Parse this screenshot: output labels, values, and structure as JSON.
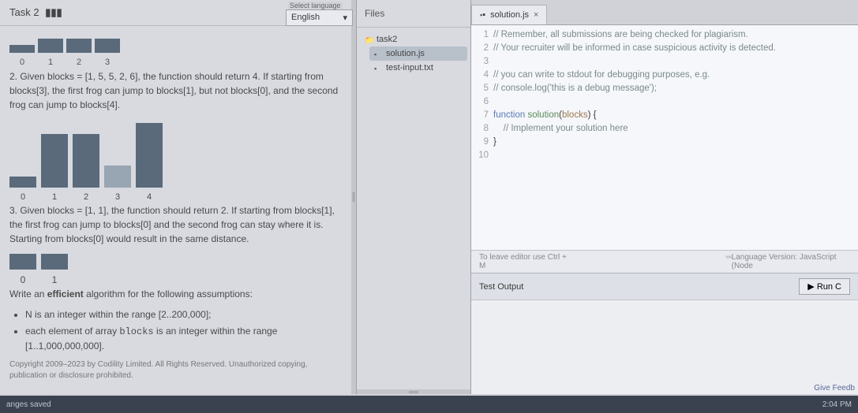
{
  "header": {
    "task_label": "Task 2",
    "lang_legend": "Select language",
    "lang_value": "English"
  },
  "problem": {
    "labels_small": [
      "0",
      "1",
      "2",
      "3"
    ],
    "p2": "2. Given blocks = [1, 5, 5, 2, 6], the function should return 4. If starting from blocks[3], the first frog can jump to blocks[1], but not blocks[0], and the second frog can jump to blocks[4].",
    "big_labels": [
      "0",
      "1",
      "2",
      "3",
      "4"
    ],
    "p3": "3. Given blocks = [1, 1], the function should return 2. If starting from blocks[1], the first frog can jump to blocks[0] and the second frog can stay where it is. Starting from blocks[0] would result in the same distance.",
    "mini_labels": [
      "0",
      "1"
    ],
    "efficient_line": "Write an ",
    "efficient_word": "efficient",
    "efficient_rest": " algorithm for the following assumptions:",
    "assumption1": "N is an integer within the range [2..200,000];",
    "assumption2a": "each element of array ",
    "assumption2b": "blocks",
    "assumption2c": " is an integer within the range [1..1,000,000,000].",
    "copyright": "Copyright 2009–2023 by Codility Limited. All Rights Reserved. Unauthorized copying, publication or disclosure prohibited."
  },
  "files": {
    "header": "Files",
    "root": "task2",
    "items": [
      "solution.js",
      "test-input.txt"
    ],
    "selected": "solution.js"
  },
  "editor": {
    "tab_name": "solution.js",
    "lines": [
      "// Remember, all submissions are being checked for plagiarism.",
      "// Your recruiter will be informed in case suspicious activity is detected.",
      "",
      "// you can write to stdout for debugging purposes, e.g.",
      "// console.log('this is a debug message');",
      "",
      "function solution(blocks) {",
      "    // Implement your solution here",
      "}",
      ""
    ],
    "line_nums": [
      "1",
      "2",
      "3",
      "4",
      "5",
      "6",
      "7",
      "8",
      "9",
      "10"
    ],
    "footer_hint": "To leave editor use Ctrl + M",
    "lang_version": "Language Version: JavaScript (Node"
  },
  "test": {
    "label": "Test Output",
    "run_label": "▶ Run C"
  },
  "bottom": {
    "left": "anges saved",
    "feedback": "Give Feedb",
    "time": "2:04 PM"
  }
}
